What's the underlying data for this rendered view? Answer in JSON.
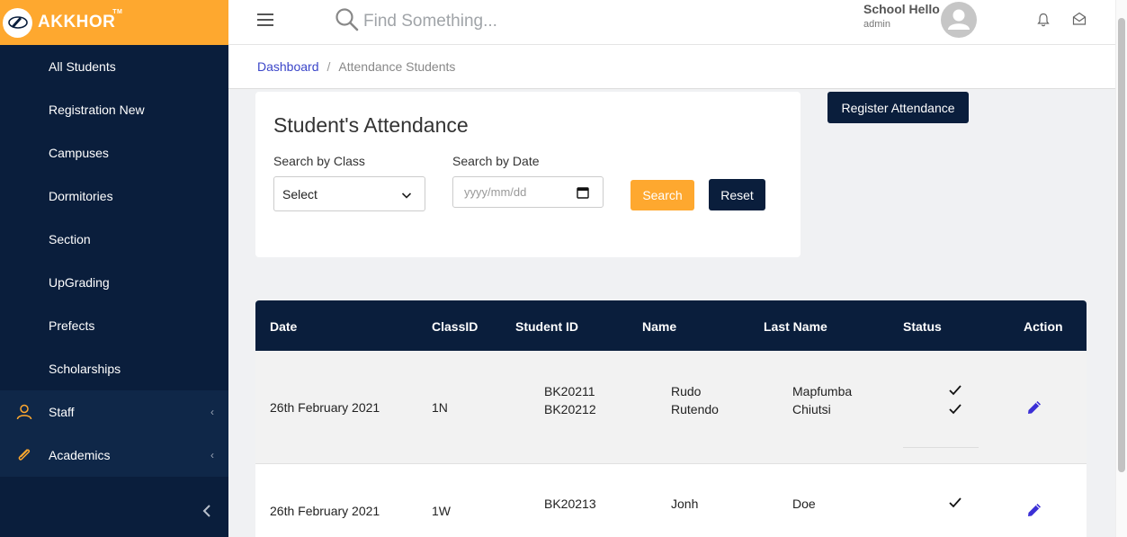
{
  "brand": {
    "name": "AKKHOR",
    "tm": "TM"
  },
  "sidebar": {
    "sub_items": [
      {
        "label": "All Students"
      },
      {
        "label": "Registration New"
      },
      {
        "label": "Campuses"
      },
      {
        "label": "Dormitories"
      },
      {
        "label": "Section"
      },
      {
        "label": "UpGrading"
      },
      {
        "label": "Prefects"
      },
      {
        "label": "Scholarships"
      }
    ],
    "main_items": [
      {
        "label": "Staff",
        "icon": "staff-icon"
      },
      {
        "label": "Academics",
        "icon": "paperclip-icon"
      }
    ]
  },
  "header": {
    "search_placeholder": "Find Something...",
    "user_name": "School Hello",
    "user_role": "admin"
  },
  "breadcrumb": {
    "home": "Dashboard",
    "separator": "/",
    "current": "Attendance Students"
  },
  "filter": {
    "title": "Student's Attendance",
    "class_label": "Search by Class",
    "class_value": "Select",
    "date_label": "Search by Date",
    "date_placeholder": "yyyy/mm/dd",
    "search_button": "Search",
    "reset_button": "Reset"
  },
  "register_button": "Register Attendance",
  "table": {
    "headers": [
      "Date",
      "ClassID",
      "Student ID",
      "Name",
      "Last Name",
      "Status",
      "Action"
    ],
    "rows": [
      {
        "date": "26th February 2021",
        "class_id": "1N",
        "student_ids": [
          "BK20211",
          "BK20212"
        ],
        "names": [
          "Rudo",
          "Rutendo"
        ],
        "last_names": [
          "Mapfumba",
          "Chiutsi"
        ]
      },
      {
        "date": "26th February 2021",
        "class_id": "1W",
        "student_ids": [
          "BK20213"
        ],
        "names": [
          "Jonh"
        ],
        "last_names": [
          "Doe"
        ]
      }
    ]
  },
  "colors": {
    "accent": "#fea82f",
    "navy": "#0a1e3c",
    "link": "#3b46c9"
  }
}
